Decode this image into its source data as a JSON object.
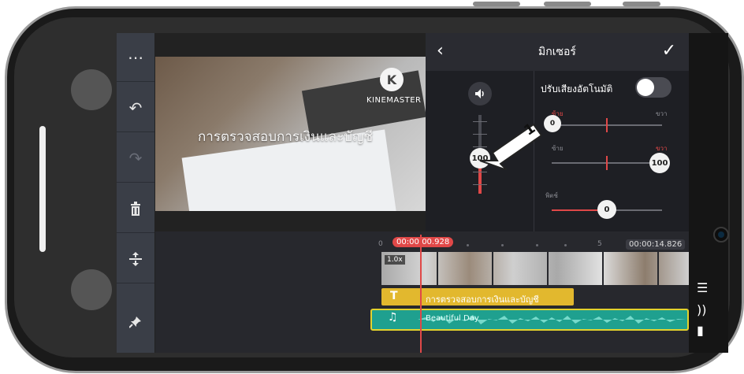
{
  "toolbar": {
    "more_icon": "⋯",
    "undo_icon": "↶",
    "redo_icon": "↷",
    "delete_icon": "🗑",
    "split_icon": "⇅",
    "pin_icon": "📌"
  },
  "preview": {
    "overlay_text": "การตรวจสอบการเงินและบัญชี",
    "watermark_letter": "K",
    "watermark_text": "KINEMASTER"
  },
  "mixer": {
    "title": "มิกเซอร์",
    "back_icon": "‹",
    "confirm_icon": "✓",
    "volume_icon": "🔊",
    "volume_value": "100",
    "auto_volume_label": "ปรับเสียงอัตโนมัติ",
    "auto_volume_enabled": false,
    "pan_left_label": "ซ้าย",
    "pan_right_label": "ขวา",
    "pan_value": "0",
    "balance_left_label": "ซ้าย",
    "balance_right_label": "ขวา",
    "balance_value": "100",
    "pitch_label": "พิตช์",
    "pitch_value": "0"
  },
  "annotation": {
    "step_number": "1"
  },
  "timeline": {
    "current_time": "00:00:00.928",
    "end_time": "00:00:14.826",
    "ruler_start": "0",
    "ruler_mark": "5",
    "video_speed": "1.0x",
    "text_clip_icon": "T",
    "text_clip_label": "การตรวจสอบการเงินและบัญชี",
    "audio_clip_icon": "♫",
    "audio_clip_label": "Beautiful Day"
  },
  "right_panel": {
    "layer_icon": "☰",
    "audio_icon": "))",
    "media_icon": "▮"
  },
  "colors": {
    "accent_red": "#e04848",
    "audio_teal": "#1fa08f",
    "text_yellow": "#e2b82e",
    "panel_dark": "#1e1f24"
  }
}
